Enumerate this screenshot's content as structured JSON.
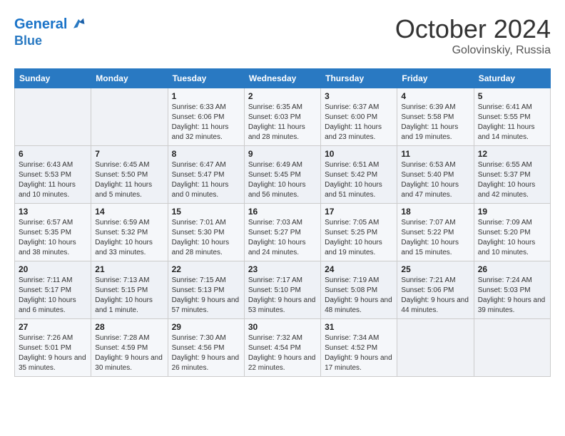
{
  "header": {
    "logo_line1": "General",
    "logo_line2": "Blue",
    "month": "October 2024",
    "location": "Golovinskiy, Russia"
  },
  "days_of_week": [
    "Sunday",
    "Monday",
    "Tuesday",
    "Wednesday",
    "Thursday",
    "Friday",
    "Saturday"
  ],
  "weeks": [
    [
      {
        "day": "",
        "sunrise": "",
        "sunset": "",
        "daylight": ""
      },
      {
        "day": "",
        "sunrise": "",
        "sunset": "",
        "daylight": ""
      },
      {
        "day": "1",
        "sunrise": "Sunrise: 6:33 AM",
        "sunset": "Sunset: 6:06 PM",
        "daylight": "Daylight: 11 hours and 32 minutes."
      },
      {
        "day": "2",
        "sunrise": "Sunrise: 6:35 AM",
        "sunset": "Sunset: 6:03 PM",
        "daylight": "Daylight: 11 hours and 28 minutes."
      },
      {
        "day": "3",
        "sunrise": "Sunrise: 6:37 AM",
        "sunset": "Sunset: 6:00 PM",
        "daylight": "Daylight: 11 hours and 23 minutes."
      },
      {
        "day": "4",
        "sunrise": "Sunrise: 6:39 AM",
        "sunset": "Sunset: 5:58 PM",
        "daylight": "Daylight: 11 hours and 19 minutes."
      },
      {
        "day": "5",
        "sunrise": "Sunrise: 6:41 AM",
        "sunset": "Sunset: 5:55 PM",
        "daylight": "Daylight: 11 hours and 14 minutes."
      }
    ],
    [
      {
        "day": "6",
        "sunrise": "Sunrise: 6:43 AM",
        "sunset": "Sunset: 5:53 PM",
        "daylight": "Daylight: 11 hours and 10 minutes."
      },
      {
        "day": "7",
        "sunrise": "Sunrise: 6:45 AM",
        "sunset": "Sunset: 5:50 PM",
        "daylight": "Daylight: 11 hours and 5 minutes."
      },
      {
        "day": "8",
        "sunrise": "Sunrise: 6:47 AM",
        "sunset": "Sunset: 5:47 PM",
        "daylight": "Daylight: 11 hours and 0 minutes."
      },
      {
        "day": "9",
        "sunrise": "Sunrise: 6:49 AM",
        "sunset": "Sunset: 5:45 PM",
        "daylight": "Daylight: 10 hours and 56 minutes."
      },
      {
        "day": "10",
        "sunrise": "Sunrise: 6:51 AM",
        "sunset": "Sunset: 5:42 PM",
        "daylight": "Daylight: 10 hours and 51 minutes."
      },
      {
        "day": "11",
        "sunrise": "Sunrise: 6:53 AM",
        "sunset": "Sunset: 5:40 PM",
        "daylight": "Daylight: 10 hours and 47 minutes."
      },
      {
        "day": "12",
        "sunrise": "Sunrise: 6:55 AM",
        "sunset": "Sunset: 5:37 PM",
        "daylight": "Daylight: 10 hours and 42 minutes."
      }
    ],
    [
      {
        "day": "13",
        "sunrise": "Sunrise: 6:57 AM",
        "sunset": "Sunset: 5:35 PM",
        "daylight": "Daylight: 10 hours and 38 minutes."
      },
      {
        "day": "14",
        "sunrise": "Sunrise: 6:59 AM",
        "sunset": "Sunset: 5:32 PM",
        "daylight": "Daylight: 10 hours and 33 minutes."
      },
      {
        "day": "15",
        "sunrise": "Sunrise: 7:01 AM",
        "sunset": "Sunset: 5:30 PM",
        "daylight": "Daylight: 10 hours and 28 minutes."
      },
      {
        "day": "16",
        "sunrise": "Sunrise: 7:03 AM",
        "sunset": "Sunset: 5:27 PM",
        "daylight": "Daylight: 10 hours and 24 minutes."
      },
      {
        "day": "17",
        "sunrise": "Sunrise: 7:05 AM",
        "sunset": "Sunset: 5:25 PM",
        "daylight": "Daylight: 10 hours and 19 minutes."
      },
      {
        "day": "18",
        "sunrise": "Sunrise: 7:07 AM",
        "sunset": "Sunset: 5:22 PM",
        "daylight": "Daylight: 10 hours and 15 minutes."
      },
      {
        "day": "19",
        "sunrise": "Sunrise: 7:09 AM",
        "sunset": "Sunset: 5:20 PM",
        "daylight": "Daylight: 10 hours and 10 minutes."
      }
    ],
    [
      {
        "day": "20",
        "sunrise": "Sunrise: 7:11 AM",
        "sunset": "Sunset: 5:17 PM",
        "daylight": "Daylight: 10 hours and 6 minutes."
      },
      {
        "day": "21",
        "sunrise": "Sunrise: 7:13 AM",
        "sunset": "Sunset: 5:15 PM",
        "daylight": "Daylight: 10 hours and 1 minute."
      },
      {
        "day": "22",
        "sunrise": "Sunrise: 7:15 AM",
        "sunset": "Sunset: 5:13 PM",
        "daylight": "Daylight: 9 hours and 57 minutes."
      },
      {
        "day": "23",
        "sunrise": "Sunrise: 7:17 AM",
        "sunset": "Sunset: 5:10 PM",
        "daylight": "Daylight: 9 hours and 53 minutes."
      },
      {
        "day": "24",
        "sunrise": "Sunrise: 7:19 AM",
        "sunset": "Sunset: 5:08 PM",
        "daylight": "Daylight: 9 hours and 48 minutes."
      },
      {
        "day": "25",
        "sunrise": "Sunrise: 7:21 AM",
        "sunset": "Sunset: 5:06 PM",
        "daylight": "Daylight: 9 hours and 44 minutes."
      },
      {
        "day": "26",
        "sunrise": "Sunrise: 7:24 AM",
        "sunset": "Sunset: 5:03 PM",
        "daylight": "Daylight: 9 hours and 39 minutes."
      }
    ],
    [
      {
        "day": "27",
        "sunrise": "Sunrise: 7:26 AM",
        "sunset": "Sunset: 5:01 PM",
        "daylight": "Daylight: 9 hours and 35 minutes."
      },
      {
        "day": "28",
        "sunrise": "Sunrise: 7:28 AM",
        "sunset": "Sunset: 4:59 PM",
        "daylight": "Daylight: 9 hours and 30 minutes."
      },
      {
        "day": "29",
        "sunrise": "Sunrise: 7:30 AM",
        "sunset": "Sunset: 4:56 PM",
        "daylight": "Daylight: 9 hours and 26 minutes."
      },
      {
        "day": "30",
        "sunrise": "Sunrise: 7:32 AM",
        "sunset": "Sunset: 4:54 PM",
        "daylight": "Daylight: 9 hours and 22 minutes."
      },
      {
        "day": "31",
        "sunrise": "Sunrise: 7:34 AM",
        "sunset": "Sunset: 4:52 PM",
        "daylight": "Daylight: 9 hours and 17 minutes."
      },
      {
        "day": "",
        "sunrise": "",
        "sunset": "",
        "daylight": ""
      },
      {
        "day": "",
        "sunrise": "",
        "sunset": "",
        "daylight": ""
      }
    ]
  ]
}
